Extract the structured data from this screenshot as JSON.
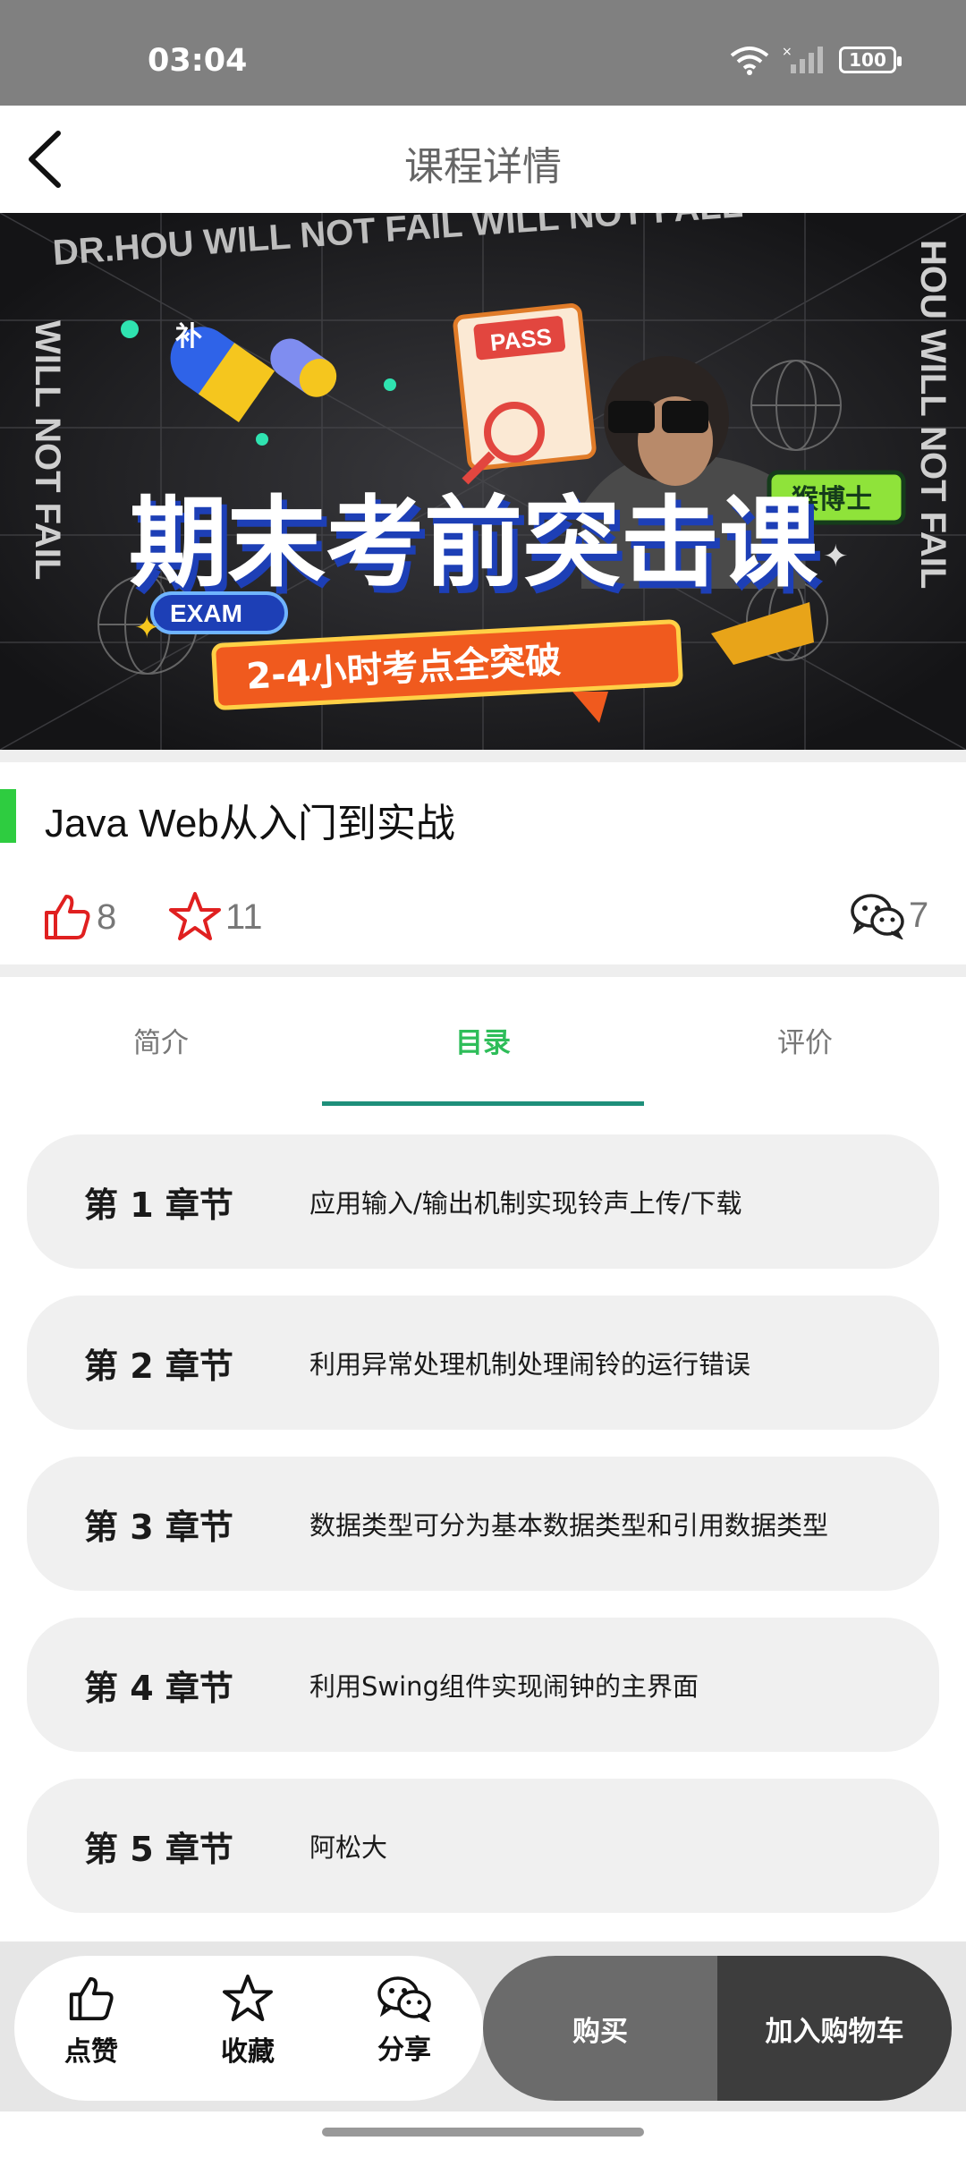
{
  "status": {
    "time": "03:04",
    "battery": "100"
  },
  "header": {
    "title": "课程详情",
    "back_icon": "chevron-left-icon"
  },
  "banner": {
    "top_text": "DR.HOU WILL NOT FAIL WILL NOT FALL",
    "side_left": "WILL NOT FAIL",
    "side_right": "HOU WILL NOT FAIL",
    "pass_tag": "PASS",
    "pill_tag": "补",
    "headline": "期末考前突击课",
    "exam_badge": "EXAM",
    "brand": "猴博士",
    "subtitle": "2-4小时考点全突破"
  },
  "course": {
    "title": "Java Web从入门到实战"
  },
  "stats": {
    "likes": "8",
    "favorites": "11",
    "comments": "7"
  },
  "tabs": [
    {
      "label": "简介",
      "active": false
    },
    {
      "label": "目录",
      "active": true
    },
    {
      "label": "评价",
      "active": false
    }
  ],
  "chapters": [
    {
      "label": "第 1 章节",
      "title": "应用输入/输出机制实现铃声上传/下载"
    },
    {
      "label": "第 2 章节",
      "title": "利用异常处理机制处理闹铃的运行错误"
    },
    {
      "label": "第 3 章节",
      "title": "数据类型可分为基本数据类型和引用数据类型"
    },
    {
      "label": "第 4 章节",
      "title": "利用Swing组件实现闹钟的主界面"
    },
    {
      "label": "第 5 章节",
      "title": "阿松大"
    }
  ],
  "bottom": {
    "like_label": "点赞",
    "favorite_label": "收藏",
    "share_label": "分享",
    "buy_label": "购买",
    "cart_label": "加入购物车"
  },
  "colors": {
    "accent_green": "#2ebd59",
    "tab_underline": "#1e8f7a",
    "like_red": "#e02020"
  }
}
